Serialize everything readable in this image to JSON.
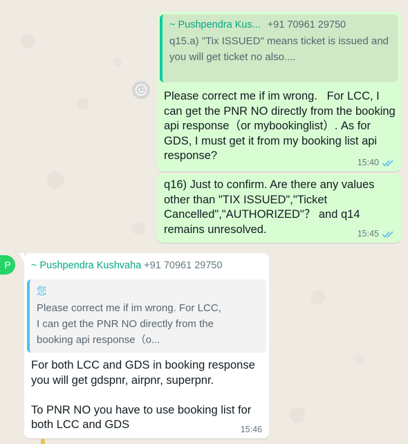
{
  "messages": {
    "m1": {
      "quote": {
        "author": "~ Pushpendra Kus...",
        "phone": "+91 70961 29750",
        "text": "q15.a) \"Tix ISSUED\" means ticket is issued and you will get ticket no also...."
      },
      "text": "Please correct me if im wrong.   For LCC, I can get the PNR NO directly from the booking api response（or mybookinglist）. As for GDS, I must get it from my booking list api response?",
      "time": "15:40"
    },
    "m2": {
      "text": "q16) Just to confirm. Are there any values other than \"TIX ISSUED\",\"Ticket Cancelled\",\"AUTHORIZED\"？ and q14 remains unresolved.",
      "time": "15:45"
    },
    "m3": {
      "sender": "~ Pushpendra Kushvaha",
      "phone": "+91 70961 29750",
      "avatar_letter": "P",
      "quote": {
        "author": "您",
        "text": "Please correct me if im wrong.   For LCC, I can get the PNR NO directly from the booking api response（o..."
      },
      "text": "For both LCC and GDS in booking response you will get gdspnr, airpnr, superpnr.\n\nTo PNR NO you have to use booking list for both LCC and GDS",
      "time": "15:46"
    }
  },
  "colors": {
    "outgoing_bubble": "#d9fdd3",
    "incoming_bubble": "#ffffff",
    "read_ticks": "#53bdeb",
    "sender_name": "#06a784"
  },
  "icons": {
    "emoji": "emoji-icon",
    "read_receipt": "double-check-icon"
  }
}
